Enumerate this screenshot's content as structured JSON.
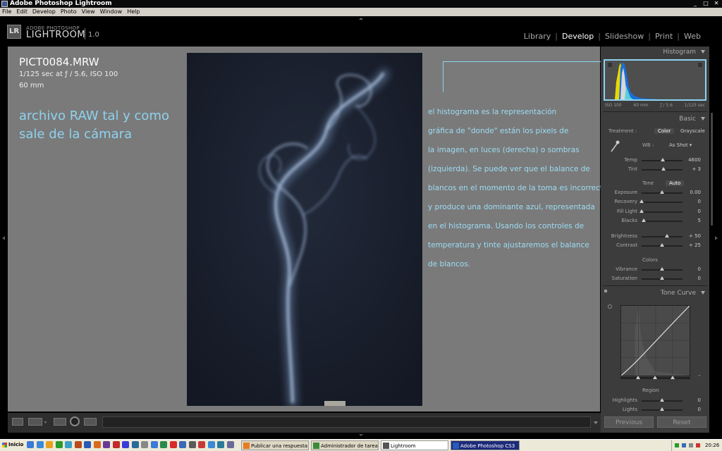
{
  "window": {
    "title": "Adobe Photoshop Lightroom"
  },
  "menu": [
    "File",
    "Edit",
    "Develop",
    "Photo",
    "View",
    "Window",
    "Help"
  ],
  "logo": {
    "badge": "LR",
    "sub": "ADOBE PHOTOSHOP",
    "main": "LIGHTROOM",
    "version": "1.0"
  },
  "modules": [
    "Library",
    "Develop",
    "Slideshow",
    "Print",
    "Web"
  ],
  "active_module": "Develop",
  "photo_info": {
    "filename": "PICT0084.MRW",
    "exposure": "1/125 sec at ƒ / 5.6, ISO 100",
    "focal": "60 mm"
  },
  "annotation_left": "archivo RAW tal y como sale de la cámara",
  "annotation_right": [
    "el histograma es la representación",
    "gráfica de \"donde\" están los pixels de",
    "la imagen, en luces (derecha) o sombras",
    "(izquierda). Se puede ver que el balance de",
    "blancos en el momento de la toma es incorrecto",
    "y produce una dominante azul, representada",
    "en el histograma. Usando los controles de",
    "temperatura y tinte ajustaremos el balance",
    "de blancos."
  ],
  "panels": {
    "histogram": {
      "title": "Histogram",
      "info": [
        "ISO 100",
        "60 mm",
        "ƒ / 5.6",
        "1/125 sec"
      ]
    },
    "basic": {
      "title": "Basic",
      "treatment_label": "Treatment :",
      "treatment_options": [
        "Color",
        "Grayscale"
      ],
      "wb_label": "WB :",
      "wb_value": "As Shot",
      "tone_label": "Tone",
      "auto_label": "Auto",
      "colors_label": "Colors",
      "sliders": [
        {
          "label": "Temp",
          "value": "4600",
          "pos": 0.52
        },
        {
          "label": "Tint",
          "value": "+ 3",
          "pos": 0.53
        },
        {
          "label": "Exposure",
          "value": "0.00",
          "pos": 0.5
        },
        {
          "label": "Recovery",
          "value": "0",
          "pos": 0.0
        },
        {
          "label": "Fill Light",
          "value": "0",
          "pos": 0.0
        },
        {
          "label": "Blacks",
          "value": "5",
          "pos": 0.05
        },
        {
          "label": "Brightness",
          "value": "+ 50",
          "pos": 0.62
        },
        {
          "label": "Contrast",
          "value": "+ 25",
          "pos": 0.5
        },
        {
          "label": "Vibrance",
          "value": "0",
          "pos": 0.5
        },
        {
          "label": "Saturation",
          "value": "0",
          "pos": 0.5
        }
      ]
    },
    "tone_curve": {
      "title": "Tone Curve",
      "region_label": "Region",
      "sliders": [
        {
          "label": "Highlights",
          "value": "0",
          "pos": 0.5
        },
        {
          "label": "Lights",
          "value": "0",
          "pos": 0.5
        }
      ]
    }
  },
  "buttons": {
    "previous": "Previous",
    "reset": "Reset"
  },
  "taskbar": {
    "start": "Inicio",
    "tasks": [
      {
        "label": "Publicar una respuesta - ..."
      },
      {
        "label": "Administrador de tareas ..."
      },
      {
        "label": "Lightroom"
      },
      {
        "label": "Adobe Photoshop CS3"
      }
    ],
    "clock": "20:26"
  },
  "colors": {
    "annotation": "#8ed2ee",
    "panel": "#3c3c3c",
    "workspace": "#7a7a7a"
  }
}
